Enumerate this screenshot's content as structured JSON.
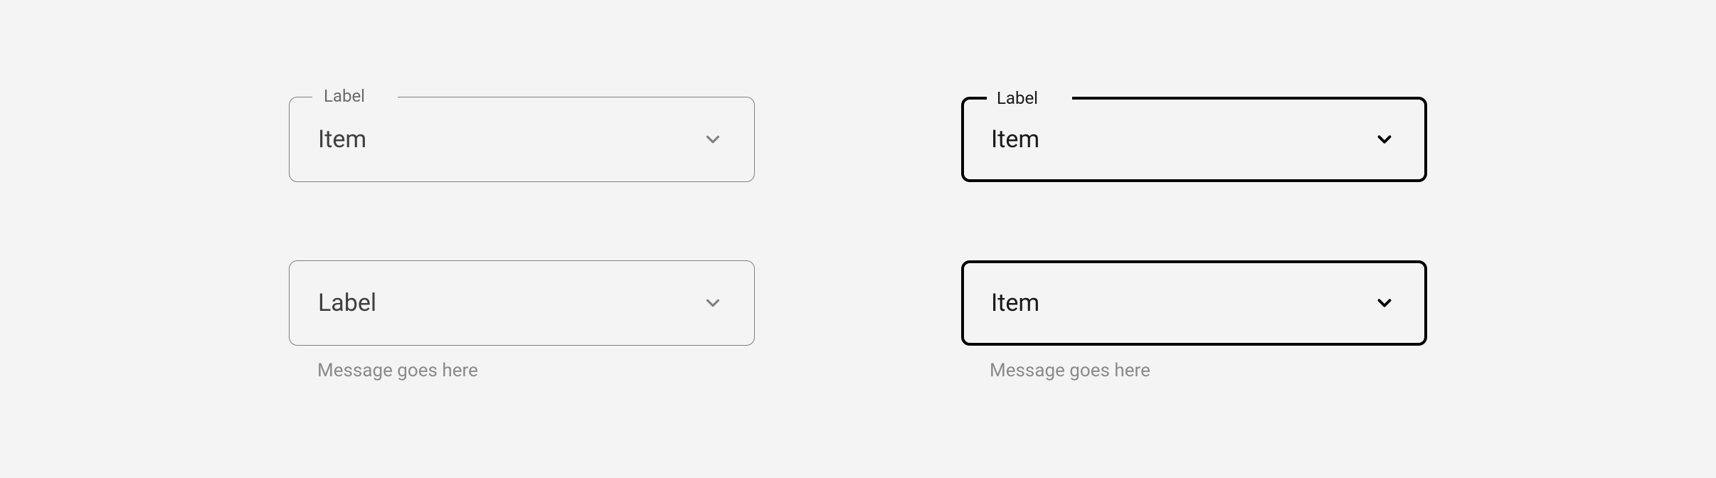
{
  "fields": {
    "topLeft": {
      "label": "Label",
      "value": "Item"
    },
    "topRight": {
      "label": "Label",
      "value": "Item"
    },
    "bottomLeft": {
      "value": "Label",
      "message": "Message goes here"
    },
    "bottomRight": {
      "value": "Item",
      "message": "Message goes here"
    }
  },
  "colors": {
    "background": "#f4f4f4",
    "borderDefault": "#808080",
    "borderFocused": "#000000",
    "textDefault": "#404040",
    "textFocused": "#1a1a1a",
    "labelDefault": "#6b6b6b",
    "helper": "#8a8a8a"
  }
}
